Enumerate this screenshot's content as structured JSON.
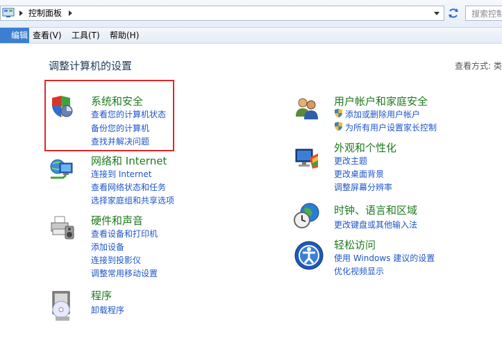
{
  "address": {
    "path": "控制面板",
    "search_placeholder": "搜索控制"
  },
  "menu": {
    "edit": "编辑(E)",
    "view": "查看(V)",
    "tools": "工具(T)",
    "help": "帮助(H)"
  },
  "content": {
    "heading": "调整计算机的设置",
    "view_by": "查看方式:  类",
    "categories": [
      {
        "title": "系统和安全",
        "links": [
          "查看您的计算机状态",
          "备份您的计算机",
          "查找并解决问题"
        ],
        "icon": "shield-icon"
      },
      {
        "title": "网络和 Internet",
        "links": [
          "连接到 Internet",
          "查看网络状态和任务",
          "选择家庭组和共享选项"
        ],
        "icon": "network-icon"
      },
      {
        "title": "硬件和声音",
        "links": [
          "查看设备和打印机",
          "添加设备",
          "连接到投影仪",
          "调整常用移动设置"
        ],
        "icon": "printer-icon"
      },
      {
        "title": "程序",
        "links": [
          "卸载程序"
        ],
        "icon": "programs-icon"
      },
      {
        "title": "用户帐户和家庭安全",
        "links": [
          "添加或删除用户帐户",
          "为所有用户设置家长控制"
        ],
        "icon": "users-icon"
      },
      {
        "title": "外观和个性化",
        "links": [
          "更改主题",
          "更改桌面背景",
          "调整屏幕分辨率"
        ],
        "icon": "appearance-icon"
      },
      {
        "title": "时钟、语言和区域",
        "links": [
          "更改键盘或其他输入法"
        ],
        "icon": "clock-globe-icon"
      },
      {
        "title": "轻松访问",
        "links": [
          "使用 Windows 建议的设置",
          "优化视频显示"
        ],
        "icon": "ease-of-access-icon"
      }
    ]
  },
  "colors": {
    "highlight": "#e0262a",
    "link": "#1e56c9",
    "category": "#1e7a1e"
  }
}
